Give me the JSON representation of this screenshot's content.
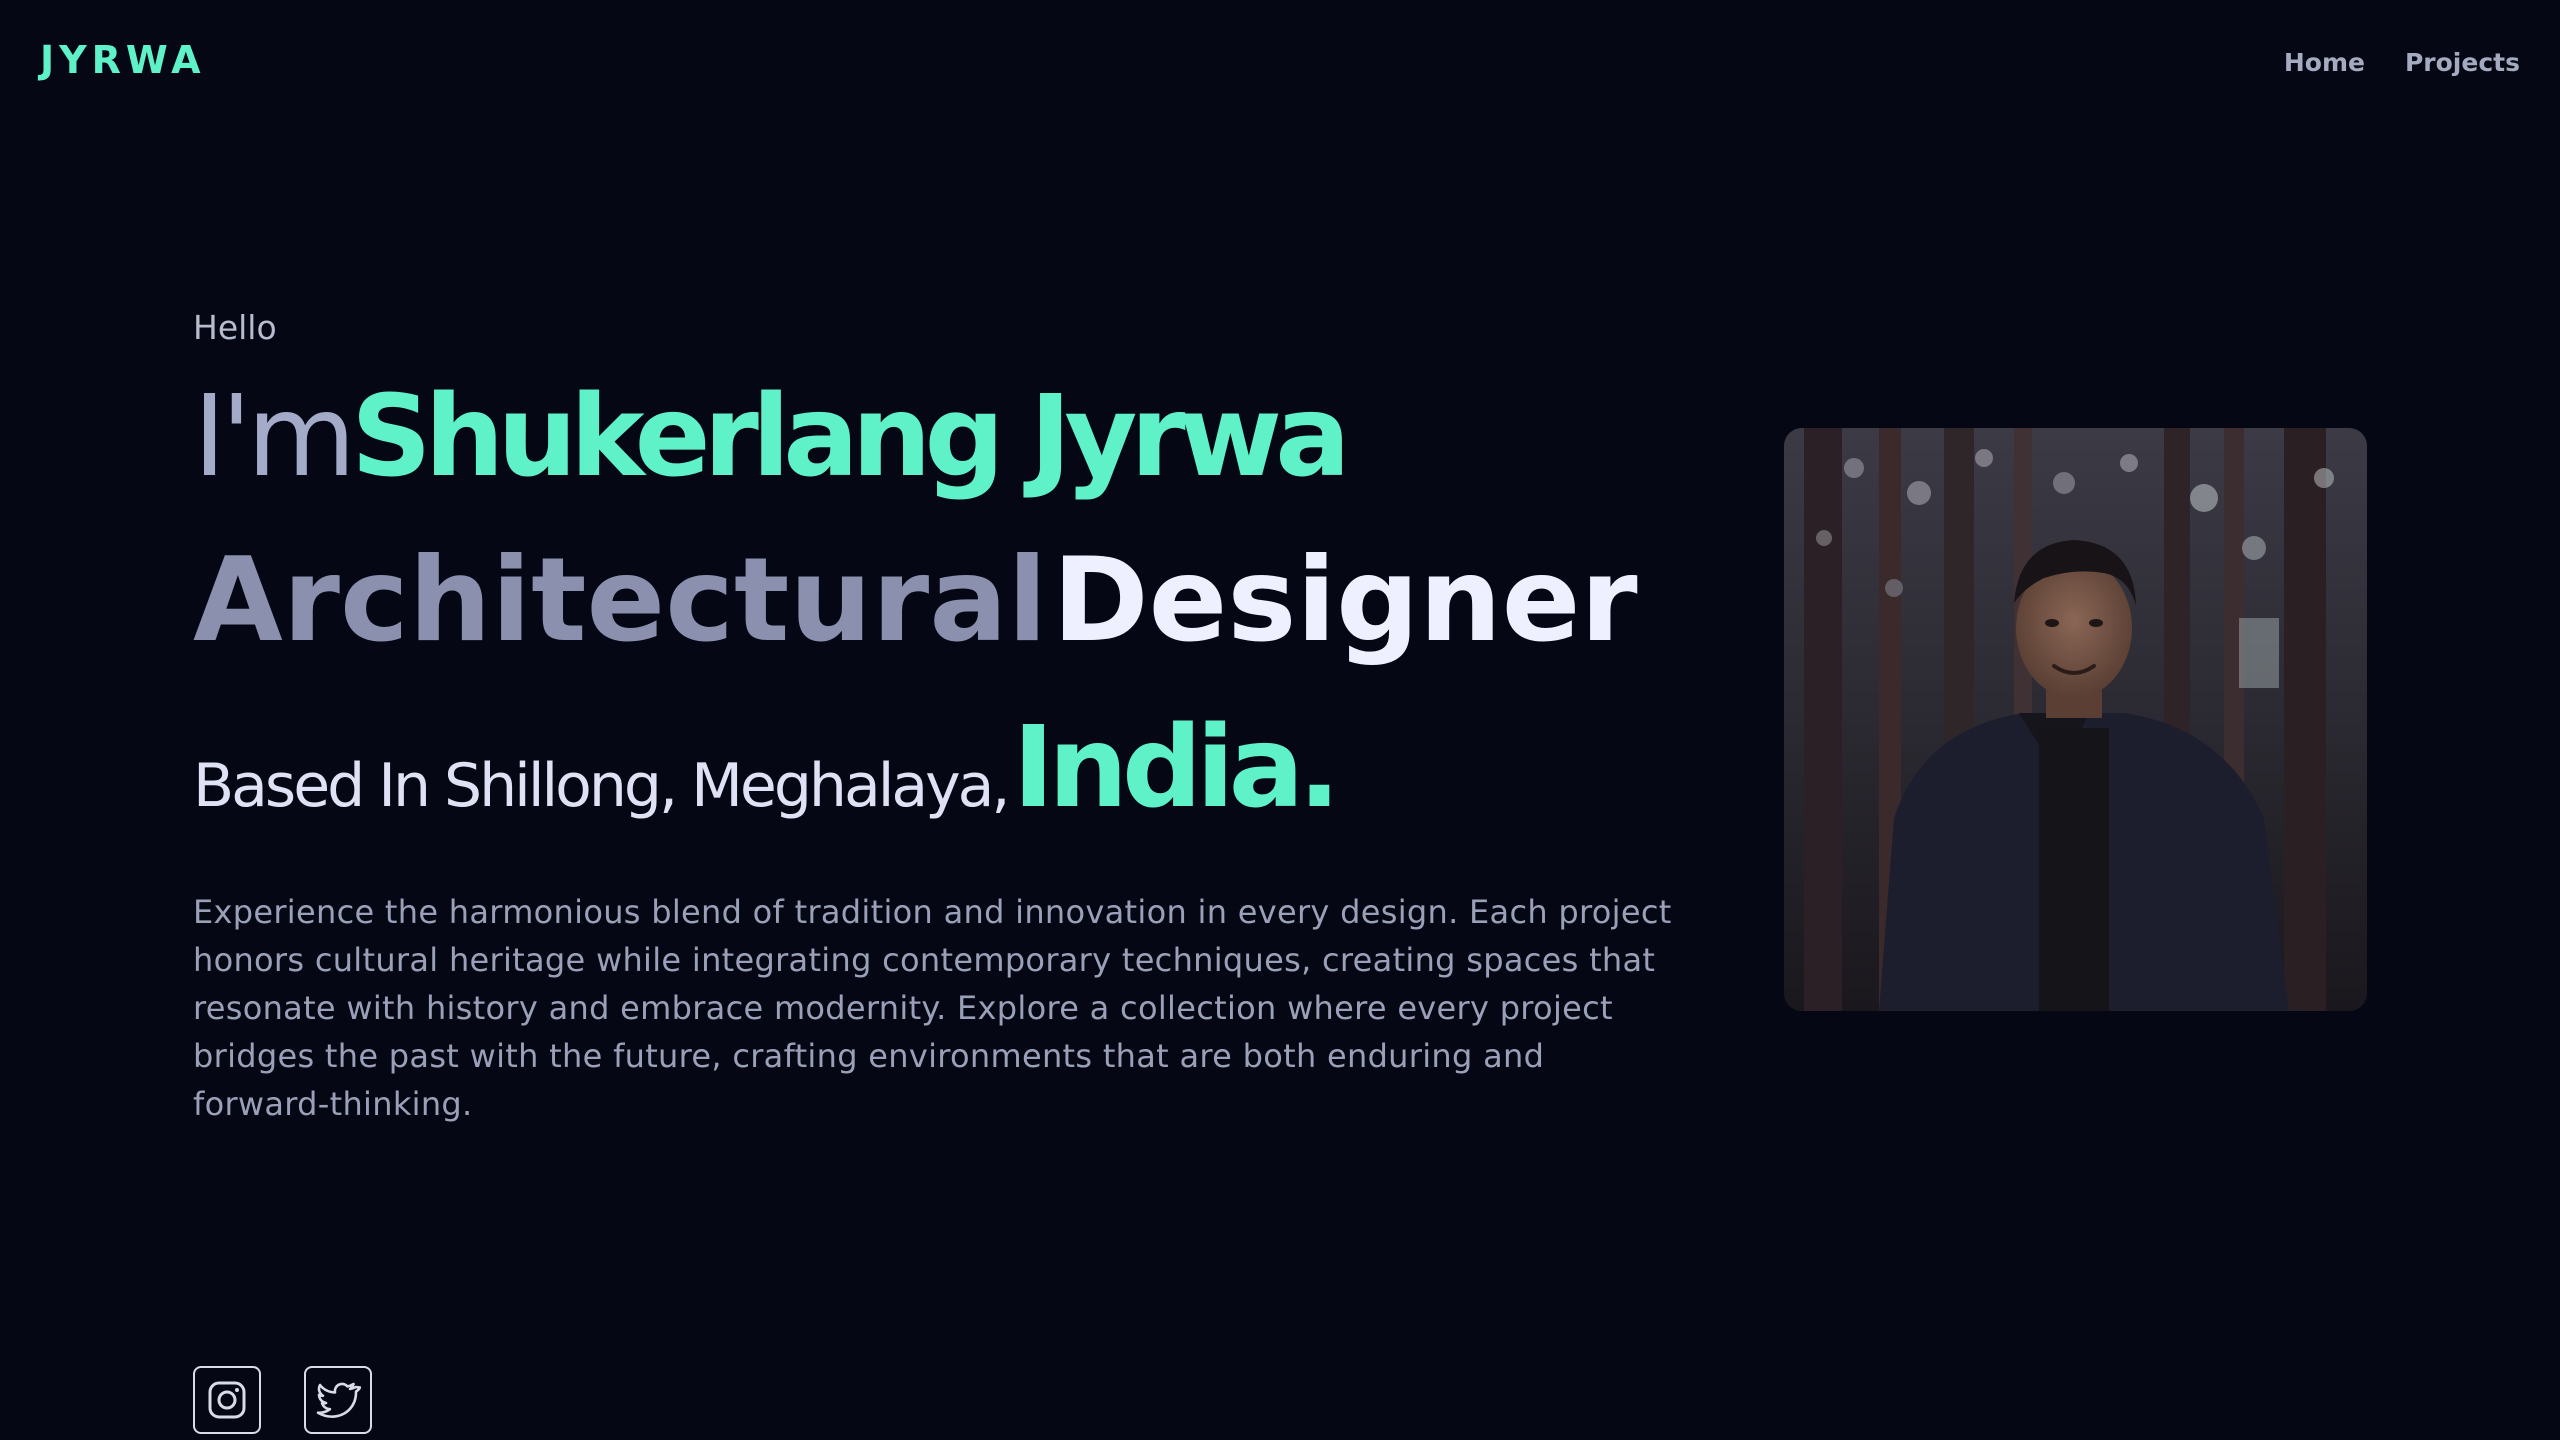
{
  "brand": {
    "logo": "JYRWA"
  },
  "nav": {
    "items": [
      {
        "label": "Home"
      },
      {
        "label": "Projects"
      }
    ]
  },
  "hero": {
    "greeting": "Hello",
    "im": "I'm",
    "name": "Shukerlang Jyrwa",
    "role_a": "Architectural",
    "role_b": "Designer",
    "location": "Based In Shillong, Meghalaya,",
    "country": "India.",
    "description": "Experience the harmonious blend of tradition and innovation in every design. Each project honors cultural heritage while integrating contemporary techniques, creating spaces that resonate with history and embrace modernity. Explore a collection where every project bridges the past with the future, crafting environments that are both enduring and forward-thinking."
  },
  "social": [
    {
      "icon": "instagram-icon"
    },
    {
      "icon": "twitter-icon"
    }
  ],
  "colors": {
    "background": "#050814",
    "accent": "#5ff2c9",
    "muted": "#8a90ad",
    "text": "#eef0ff"
  }
}
